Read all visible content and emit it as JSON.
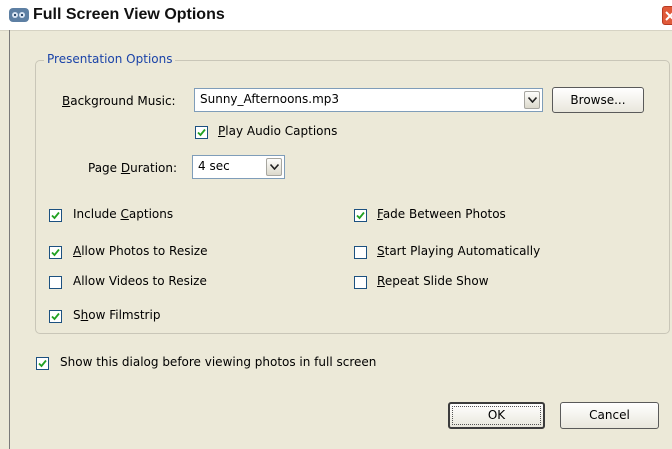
{
  "window": {
    "title": "Full Screen View Options",
    "icon": "photo-app-icon"
  },
  "group": {
    "label": "Presentation Options"
  },
  "background_music": {
    "label_prefix": "",
    "label_mnemonic": "B",
    "label_rest": "ackground Music:",
    "value": "Sunny_Afternoons.mp3",
    "browse_label": "Browse..."
  },
  "play_audio_captions": {
    "checked": true,
    "mnemonic": "P",
    "rest": "lay Audio Captions"
  },
  "page_duration": {
    "label_prefix": "Page ",
    "label_mnemonic": "D",
    "label_rest": "uration:",
    "value": "4 sec"
  },
  "options_left": [
    {
      "checked": true,
      "pre": "Include ",
      "mnemonic": "C",
      "rest": "aptions"
    },
    {
      "checked": true,
      "pre": "",
      "mnemonic": "A",
      "rest": "llow Photos to Resize"
    },
    {
      "checked": false,
      "pre": "Allow Videos to Resize",
      "mnemonic": "",
      "rest": ""
    },
    {
      "checked": true,
      "pre": "S",
      "mnemonic": "h",
      "rest": "ow Filmstrip"
    }
  ],
  "options_right": [
    {
      "checked": true,
      "pre": "",
      "mnemonic": "F",
      "rest": "ade Between Photos"
    },
    {
      "checked": false,
      "pre": "",
      "mnemonic": "S",
      "rest": "tart Playing Automatically"
    },
    {
      "checked": false,
      "pre": "",
      "mnemonic": "R",
      "rest": "epeat Slide Show"
    }
  ],
  "show_dialog": {
    "checked": true,
    "label": "Show this dialog before viewing photos in full screen"
  },
  "buttons": {
    "ok": "OK",
    "cancel": "Cancel"
  },
  "colors": {
    "dialog_bg": "#ece9d8",
    "group_label": "#1a43a8",
    "check_mark": "#21a121"
  }
}
